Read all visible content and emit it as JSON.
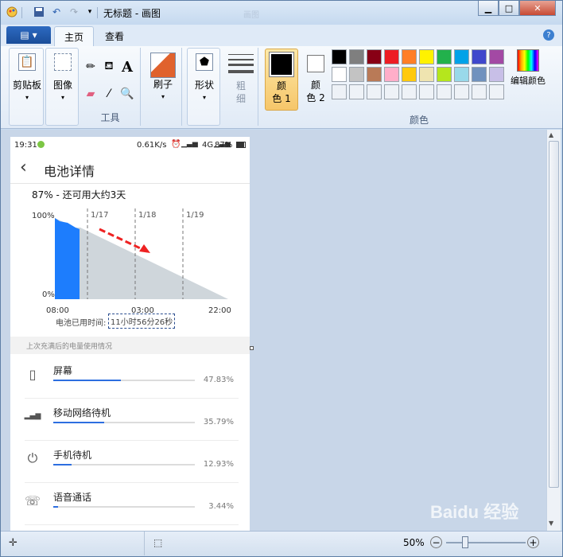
{
  "titlebar": {
    "title": "无标题 - 画图",
    "faded_label": "画图"
  },
  "tabs": {
    "file_icon": "▤",
    "home": "主页",
    "view": "查看"
  },
  "help": {
    "label": "?"
  },
  "ribbon": {
    "clipboard": "剪贴板",
    "image": "图像",
    "tools_group": "工具",
    "brushes": "刷子",
    "shapes": "形状",
    "size_line1": "粗",
    "size_line2": "细",
    "color1_line1": "颜",
    "color1_line2": "色 1",
    "color2_line1": "颜",
    "color2_line2": "色 2",
    "colors_group": "颜色",
    "edit_colors": "编辑颜色",
    "text_tool": "A"
  },
  "palette_row1": [
    "#000000",
    "#7f7f7f",
    "#880015",
    "#ed1c24",
    "#ff7f27",
    "#fff200",
    "#22b14c",
    "#00a2e8",
    "#3f48cc",
    "#a349a4"
  ],
  "palette_row2": [
    "#ffffff",
    "#c3c3c3",
    "#b97a57",
    "#ffaec9",
    "#ffc90e",
    "#efe4b0",
    "#b5e61d",
    "#99d9ea",
    "#7092be",
    "#c8bfe7"
  ],
  "phone": {
    "time": "19:31",
    "speed": "0.61K/s",
    "network": "4G",
    "battery": "87%",
    "page_title": "电池详情",
    "summary": "87% - 还可用大约3天",
    "y_top": "100%",
    "y_bottom": "0%",
    "dates": [
      "1/17",
      "1/18",
      "1/19"
    ],
    "x_labels": [
      "08:00",
      "03:00",
      "22:00"
    ],
    "used_label": "电池已用时间:",
    "used_value": "11小时56分26秒",
    "section": "上次充满后的电量使用情况",
    "usage": [
      {
        "label": "屏幕",
        "pct": "47.83%",
        "value": 0.4783,
        "icon": "phone-icon"
      },
      {
        "label": "移动网络待机",
        "pct": "35.79%",
        "value": 0.3579,
        "icon": "signal-icon"
      },
      {
        "label": "手机待机",
        "pct": "12.93%",
        "value": 0.1293,
        "icon": "power-icon"
      },
      {
        "label": "语音通话",
        "pct": "3.44%",
        "value": 0.0344,
        "icon": "call-icon"
      }
    ]
  },
  "status": {
    "zoom": "50%"
  },
  "watermark": "Baidu 经验"
}
